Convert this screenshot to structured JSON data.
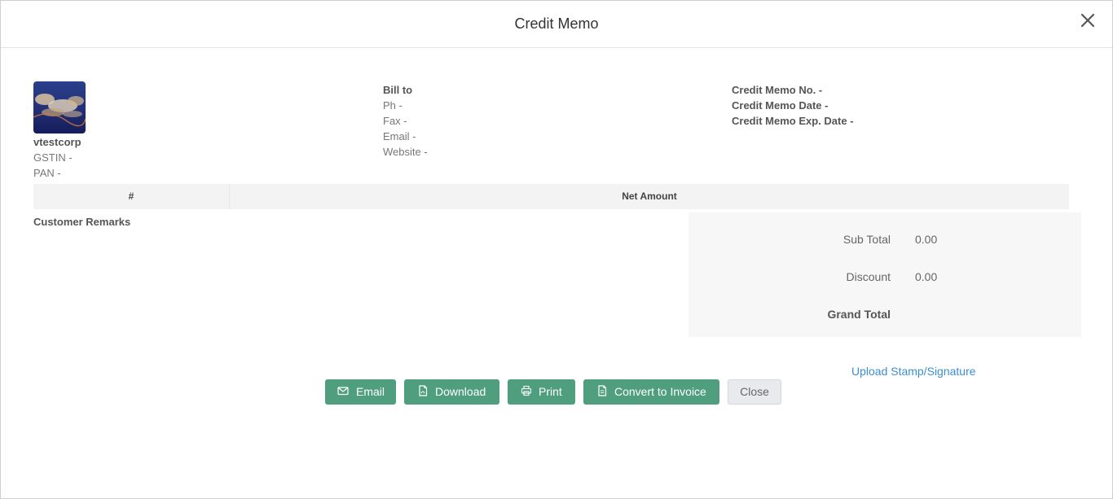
{
  "modal": {
    "title": "Credit Memo"
  },
  "company": {
    "name": "vtestcorp",
    "gstin": "GSTIN -",
    "pan": "PAN -"
  },
  "bill_to": {
    "heading": "Bill to",
    "ph": "Ph -",
    "fax": "Fax -",
    "email": "Email -",
    "website": "Website -"
  },
  "memo": {
    "number": "Credit Memo No. -",
    "date": "Credit Memo Date -",
    "exp_date": "Credit Memo Exp. Date -"
  },
  "table": {
    "col_hash": "#",
    "col_net": "Net Amount"
  },
  "remarks_label": "Customer Remarks",
  "totals": {
    "sub_total_label": "Sub Total",
    "sub_total_value": "0.00",
    "discount_label": "Discount",
    "discount_value": "0.00",
    "grand_total_label": "Grand Total"
  },
  "upload_link": "Upload Stamp/Signature",
  "buttons": {
    "email": "Email",
    "download": "Download",
    "print": "Print",
    "convert": "Convert to Invoice",
    "close": "Close"
  },
  "icons": {
    "close": "close-icon",
    "email": "envelope-icon",
    "download": "pdf-file-icon",
    "print": "printer-icon",
    "convert": "document-icon"
  },
  "colors": {
    "primary_button": "#4f9f7e",
    "link": "#3a8fd1"
  }
}
